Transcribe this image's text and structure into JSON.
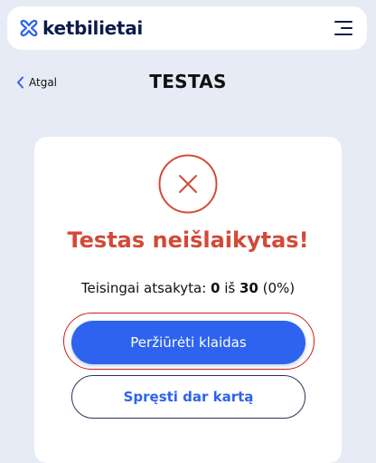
{
  "brand": {
    "name": "ketbilietai",
    "accent": "#2e63ef",
    "dark": "#0c1b4d"
  },
  "header": {
    "menu_icon": "hamburger-menu-icon"
  },
  "nav": {
    "back_label": "Atgal",
    "back_icon": "chevron-left-icon"
  },
  "page": {
    "title": "TESTAS"
  },
  "result": {
    "icon": "x-circle-icon",
    "icon_color": "#d24a38",
    "title": "Testas neišlaikytas!",
    "score_prefix": "Teisingai atsakyta: ",
    "correct": "0",
    "separator": " iš ",
    "total": "30",
    "percent": " (0%)"
  },
  "actions": {
    "review_label": "Peržiūrėti klaidas",
    "retry_label": "Spręsti dar kartą"
  }
}
